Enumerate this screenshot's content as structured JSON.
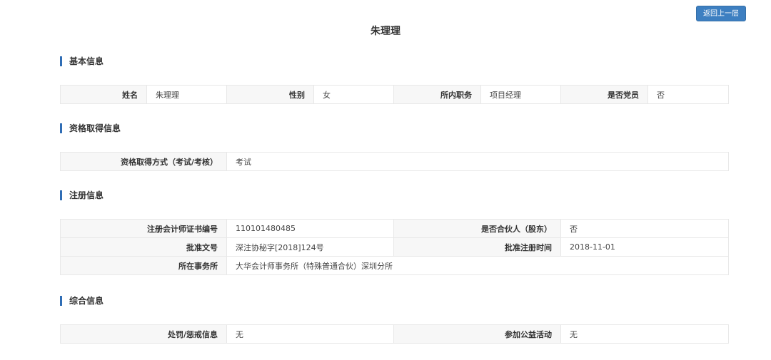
{
  "header": {
    "back_label": "返回上一层",
    "title": "朱理理"
  },
  "sections": {
    "basic": {
      "title": "基本信息",
      "name_label": "姓名",
      "name_value": "朱理理",
      "gender_label": "性别",
      "gender_value": "女",
      "position_label": "所内职务",
      "position_value": "项目经理",
      "party_label": "是否党员",
      "party_value": "否"
    },
    "qualification": {
      "title": "资格取得信息",
      "method_label": "资格取得方式（考试/考核）",
      "method_value": "考试"
    },
    "registration": {
      "title": "注册信息",
      "cert_label": "注册会计师证书编号",
      "cert_value": "110101480485",
      "partner_label": "是否合伙人（股东）",
      "partner_value": "否",
      "approval_label": "批准文号",
      "approval_value": "深注协秘字[2018]124号",
      "approval_date_label": "批准注册时间",
      "approval_date_value": "2018-11-01",
      "firm_label": "所在事务所",
      "firm_value": "大华会计师事务所（特殊普通合伙）深圳分所"
    },
    "general": {
      "title": "综合信息",
      "penalty_label": "处罚/惩戒信息",
      "penalty_value": "无",
      "charity_label": "参加公益活动",
      "charity_value": "无"
    }
  }
}
